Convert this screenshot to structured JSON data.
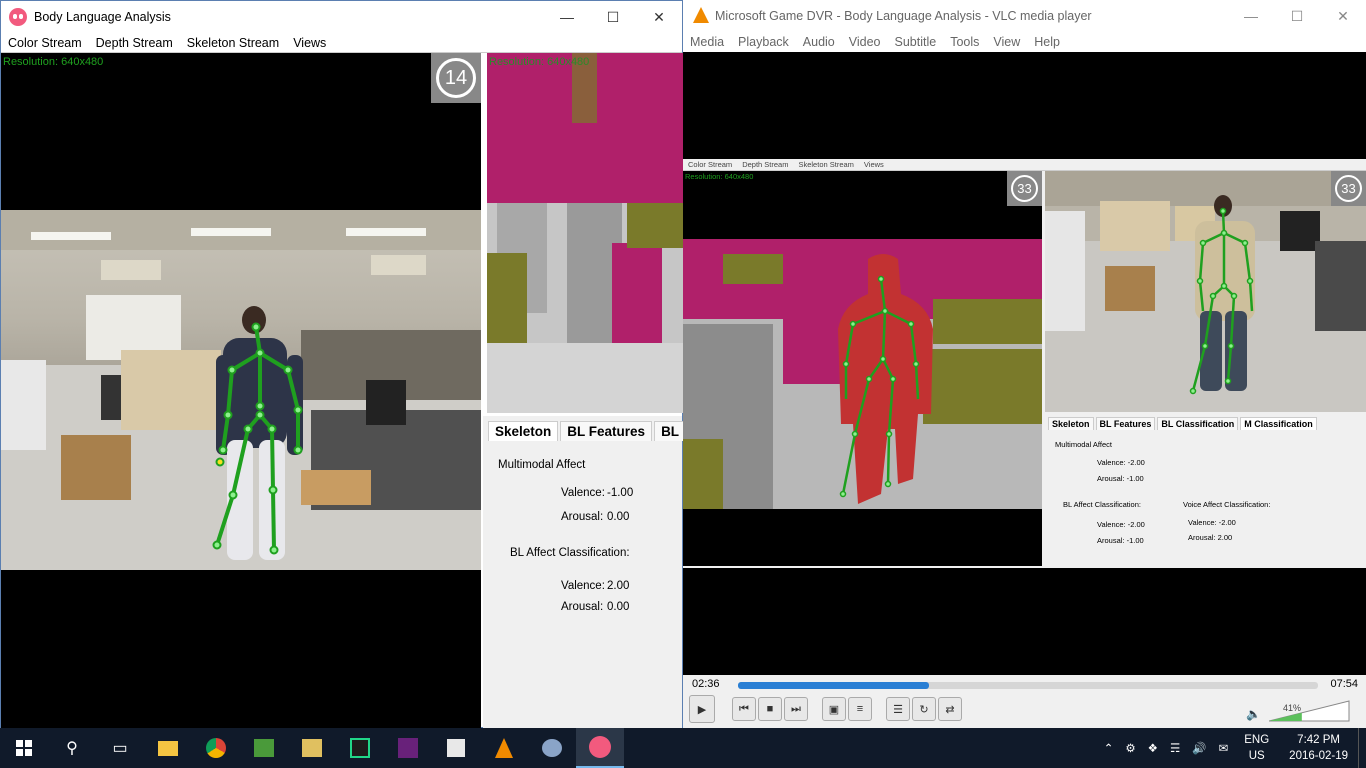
{
  "left_window": {
    "title": "Body Language Analysis",
    "menu": [
      "Color Stream",
      "Depth Stream",
      "Skeleton Stream",
      "Views"
    ],
    "color_resolution": "Resolution: 640x480",
    "depth_resolution": "Resolution: 640x480",
    "frame_counter": "14",
    "tabs": [
      "Skeleton",
      "BL Features",
      "BL C"
    ],
    "multimodal_heading": "Multimodal Affect",
    "mm_valence_label": "Valence:",
    "mm_valence": "-1.00",
    "mm_arousal_label": "Arousal:",
    "mm_arousal": "0.00",
    "bl_heading": "BL Affect Classification:",
    "bl_valence_label": "Valence:",
    "bl_valence": "2.00",
    "bl_arousal_label": "Arousal:",
    "bl_arousal": "0.00"
  },
  "vlc_window": {
    "title": "Microsoft Game DVR - Body Language Analysis - VLC media player",
    "menu": [
      "Media",
      "Playback",
      "Audio",
      "Video",
      "Subtitle",
      "Tools",
      "View",
      "Help"
    ],
    "elapsed": "02:36",
    "total": "07:54",
    "progress_fraction": 0.33,
    "volume": "41%",
    "inner": {
      "menu": [
        "Color Stream",
        "Depth Stream",
        "Skeleton Stream",
        "Views"
      ],
      "resolution": "Resolution: 640x480",
      "counter_left": "33",
      "counter_right": "33",
      "tabs": [
        "Skeleton",
        "BL Features",
        "BL Classification",
        "M Classification"
      ],
      "multimodal_heading": "Multimodal Affect",
      "mm_valence": "Valence: -2.00",
      "mm_arousal": "Arousal: -1.00",
      "bl_heading": "BL Affect Classification:",
      "bl_valence": "Valence: -2.00",
      "bl_arousal": "Arousal: -1.00",
      "voice_heading": "Voice Affect Classification:",
      "voice_valence": "Valence: -2.00",
      "voice_arousal": "Arousal: 2.00"
    }
  },
  "taskbar": {
    "lang_top": "ENG",
    "lang_bottom": "US",
    "time": "7:42 PM",
    "date": "2016-02-19"
  },
  "colors": {
    "skeleton": "#1fa01f",
    "joint": "#8ef08e",
    "depth_magenta": "#b0206a",
    "depth_olive": "#7a7a2a",
    "player_red": "#c23232"
  }
}
